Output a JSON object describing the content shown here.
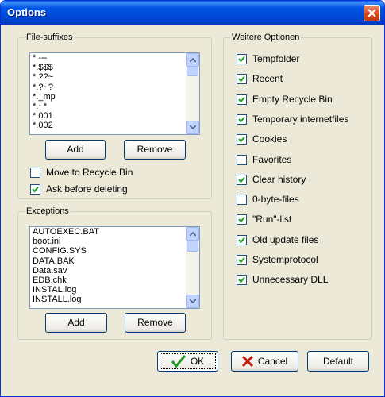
{
  "window": {
    "title": "Options"
  },
  "file_suffixes": {
    "legend": "File-suffixes",
    "items": [
      "*.---",
      "*.$$$",
      "*.??~",
      "*.?~?",
      "*._mp",
      "*.~*",
      "*.001",
      "*.002"
    ],
    "add_label": "Add",
    "remove_label": "Remove",
    "move_recycle": {
      "label": "Move to Recycle Bin",
      "checked": false
    },
    "ask_delete": {
      "label": "Ask before deleting",
      "checked": true
    }
  },
  "exceptions": {
    "legend": "Exceptions",
    "items": [
      "AUTOEXEC.BAT",
      "boot.ini",
      "CONFIG.SYS",
      "DATA.BAK",
      "Data.sav",
      "EDB.chk",
      "INSTAL.log",
      "INSTALL.log"
    ],
    "add_label": "Add",
    "remove_label": "Remove"
  },
  "options": {
    "legend": "Weitere Optionen",
    "items": [
      {
        "label": "Tempfolder",
        "checked": true
      },
      {
        "label": "Recent",
        "checked": true
      },
      {
        "label": "Empty Recycle Bin",
        "checked": true
      },
      {
        "label": "Temporary internetfiles",
        "checked": true
      },
      {
        "label": "Cookies",
        "checked": true
      },
      {
        "label": "Favorites",
        "checked": false
      },
      {
        "label": "Clear history",
        "checked": true
      },
      {
        "label": "0-byte-files",
        "checked": false
      },
      {
        "label": "\"Run\"-list",
        "checked": true
      },
      {
        "label": "Old update files",
        "checked": true
      },
      {
        "label": "Systemprotocol",
        "checked": true
      },
      {
        "label": "Unnecessary DLL",
        "checked": true
      }
    ]
  },
  "footer": {
    "ok_label": "OK",
    "cancel_label": "Cancel",
    "default_label": "Default"
  },
  "colors": {
    "check": "#21a121",
    "close": "#d6461e",
    "cancel_x": "#c4200f",
    "ok_check": "#229922"
  }
}
